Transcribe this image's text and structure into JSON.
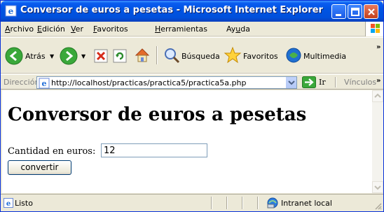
{
  "window": {
    "title": "Conversor de euros a pesetas - Microsoft Internet Explorer"
  },
  "menu": {
    "items": [
      {
        "pre": "",
        "ul": "A",
        "post": "rchivo"
      },
      {
        "pre": "",
        "ul": "E",
        "post": "dición"
      },
      {
        "pre": "",
        "ul": "V",
        "post": "er"
      },
      {
        "pre": "",
        "ul": "F",
        "post": "avoritos"
      },
      {
        "pre": "",
        "ul": "H",
        "post": "erramientas"
      },
      {
        "pre": "Ay",
        "ul": "u",
        "post": "da"
      }
    ]
  },
  "toolbar": {
    "back_label": "Atrás",
    "search_label": "Búsqueda",
    "favorites_label": "Favoritos",
    "multimedia_label": "Multimedia"
  },
  "address": {
    "label": "Dirección",
    "url": "http://localhost/practicas/practica5/practica5a.php",
    "go_label": "Ir",
    "links_label": "Vínculos"
  },
  "page": {
    "heading": "Conversor de euros a pesetas",
    "field_label": "Cantidad en euros:",
    "field_value": "12",
    "submit_label": "convertir"
  },
  "status": {
    "text": "Listo",
    "zone": "Intranet local"
  },
  "colors": {
    "titlebar": "#0054e3",
    "chrome": "#ece9d8",
    "back_arrow": "#3aa83a",
    "stop_red": "#d62c1a"
  }
}
